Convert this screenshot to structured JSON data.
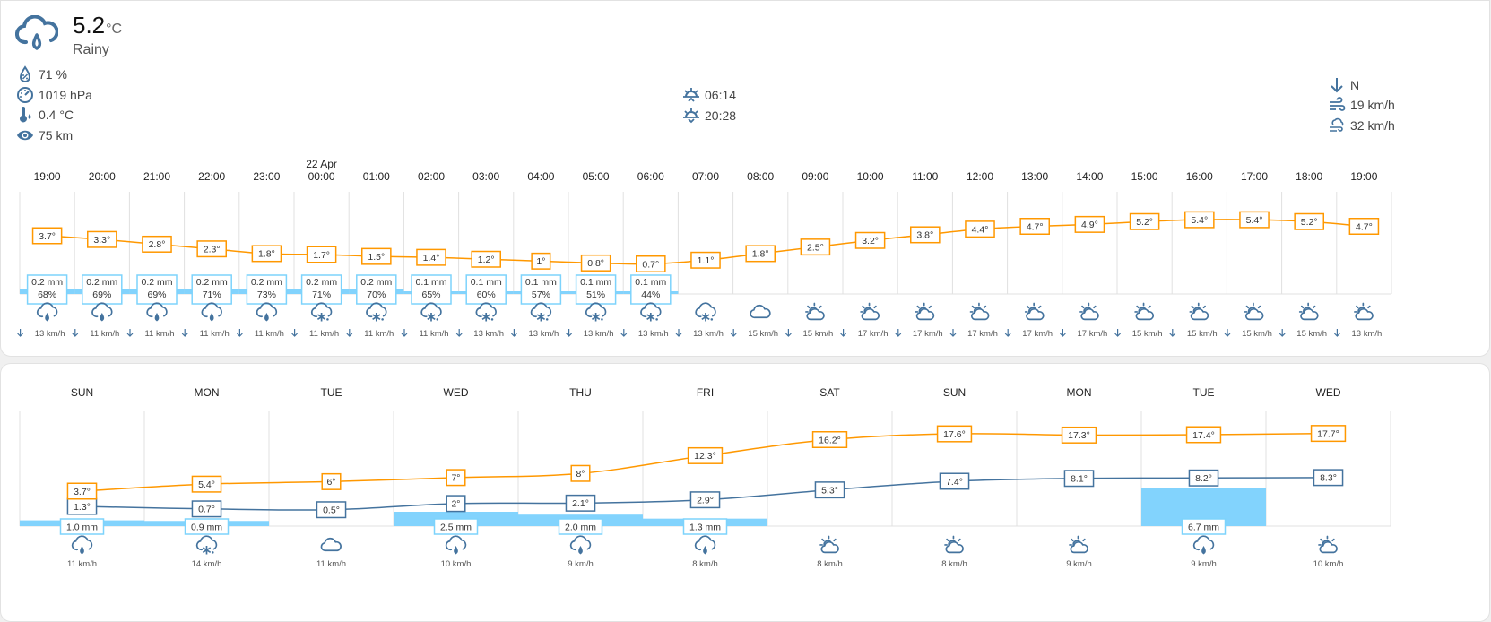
{
  "current": {
    "temperature": "5.2",
    "unit": "°C",
    "condition": "Rainy",
    "humidity": "71 %",
    "pressure": "1019 hPa",
    "dew_point": "0.4 °C",
    "visibility": "75 km",
    "sunrise": "06:14",
    "sunset": "20:28",
    "wind_bearing": "N",
    "wind_speed": "19 km/h",
    "wind_gust": "32 km/h"
  },
  "hourly": {
    "date_label": "22 Apr",
    "times": [
      "19:00",
      "20:00",
      "21:00",
      "22:00",
      "23:00",
      "00:00",
      "01:00",
      "02:00",
      "03:00",
      "04:00",
      "05:00",
      "06:00",
      "07:00",
      "08:00",
      "09:00",
      "10:00",
      "11:00",
      "12:00",
      "13:00",
      "14:00",
      "15:00",
      "16:00",
      "17:00",
      "18:00",
      "19:00"
    ],
    "temps": [
      3.7,
      3.3,
      2.8,
      2.3,
      1.8,
      1.7,
      1.5,
      1.4,
      1.2,
      1,
      0.8,
      0.7,
      1.1,
      1.8,
      2.5,
      3.2,
      3.8,
      4.4,
      4.7,
      4.9,
      5.2,
      5.4,
      5.4,
      5.2,
      4.7
    ],
    "temp_labels": [
      "3.7°",
      "3.3°",
      "2.8°",
      "2.3°",
      "1.8°",
      "1.7°",
      "1.5°",
      "1.4°",
      "1.2°",
      "1°",
      "0.8°",
      "0.7°",
      "1.1°",
      "1.8°",
      "2.5°",
      "3.2°",
      "3.8°",
      "4.4°",
      "4.7°",
      "4.9°",
      "5.2°",
      "5.4°",
      "5.4°",
      "5.2°",
      "4.7°"
    ],
    "precip_amount": [
      "0.2 mm",
      "0.2 mm",
      "0.2 mm",
      "0.2 mm",
      "0.2 mm",
      "0.2 mm",
      "0.2 mm",
      "0.1 mm",
      "0.1 mm",
      "0.1 mm",
      "0.1 mm",
      "0.1 mm"
    ],
    "precip_prob": [
      "68%",
      "69%",
      "69%",
      "71%",
      "73%",
      "71%",
      "70%",
      "65%",
      "60%",
      "57%",
      "51%",
      "44%"
    ],
    "icons": [
      "rainy-icon",
      "rainy-icon",
      "rainy-icon",
      "rainy-icon",
      "rainy-icon",
      "snowy-rainy-icon",
      "snowy-rainy-icon",
      "snowy-rainy-icon",
      "snowy-rainy-icon",
      "snowy-rainy-icon",
      "snowy-rainy-icon",
      "snowy-rainy-icon",
      "snowy-rainy-icon",
      "cloudy-icon",
      "partly-cloudy-icon",
      "partly-cloudy-icon",
      "partly-cloudy-icon",
      "partly-cloudy-icon",
      "partly-cloudy-icon",
      "partly-cloudy-icon",
      "partly-cloudy-icon",
      "partly-cloudy-icon",
      "partly-cloudy-icon",
      "partly-cloudy-icon",
      "partly-cloudy-icon"
    ],
    "winds": [
      "13 km/h",
      "11 km/h",
      "11 km/h",
      "11 km/h",
      "11 km/h",
      "11 km/h",
      "11 km/h",
      "11 km/h",
      "13 km/h",
      "13 km/h",
      "13 km/h",
      "13 km/h",
      "13 km/h",
      "15 km/h",
      "15 km/h",
      "17 km/h",
      "17 km/h",
      "17 km/h",
      "17 km/h",
      "17 km/h",
      "15 km/h",
      "15 km/h",
      "15 km/h",
      "15 km/h",
      "13 km/h"
    ]
  },
  "daily": {
    "days": [
      "SUN",
      "MON",
      "TUE",
      "WED",
      "THU",
      "FRI",
      "SAT",
      "SUN",
      "MON",
      "TUE",
      "WED"
    ],
    "high": [
      3.7,
      5.4,
      6,
      7,
      8,
      12.3,
      16.2,
      17.6,
      17.3,
      17.4,
      17.7
    ],
    "high_labels": [
      "3.7°",
      "5.4°",
      "6°",
      "7°",
      "8°",
      "12.3°",
      "16.2°",
      "17.6°",
      "17.3°",
      "17.4°",
      "17.7°"
    ],
    "low": [
      1.3,
      0.7,
      0.5,
      2,
      2.1,
      2.9,
      5.3,
      7.4,
      8.1,
      8.2,
      8.3
    ],
    "low_labels": [
      "1.3°",
      "0.7°",
      "0.5°",
      "2°",
      "2.1°",
      "2.9°",
      "5.3°",
      "7.4°",
      "8.1°",
      "8.2°",
      "8.3°"
    ],
    "precip": [
      1.0,
      0.9,
      0,
      2.5,
      2.0,
      1.3,
      0,
      0,
      0,
      6.7,
      0
    ],
    "precip_labels": [
      "1.0 mm",
      "0.9 mm",
      "",
      "2.5 mm",
      "2.0 mm",
      "1.3 mm",
      "",
      "",
      "",
      "6.7 mm",
      ""
    ],
    "icons": [
      "rainy-icon",
      "snowy-rainy-icon",
      "cloudy-icon",
      "rainy-icon",
      "rainy-icon",
      "rainy-icon",
      "partly-cloudy-icon",
      "partly-cloudy-icon",
      "partly-cloudy-icon",
      "rainy-icon",
      "partly-cloudy-icon"
    ],
    "winds": [
      "11 km/h",
      "14 km/h",
      "11 km/h",
      "10 km/h",
      "9 km/h",
      "8 km/h",
      "8 km/h",
      "8 km/h",
      "9 km/h",
      "9 km/h",
      "10 km/h"
    ]
  },
  "colors": {
    "high_line": "#ff9800",
    "low_line": "#44739e",
    "precip": "#82d3fd",
    "precip_border": "#7dd3fc",
    "icon": "#44739e",
    "grid": "#e0e0e0"
  }
}
